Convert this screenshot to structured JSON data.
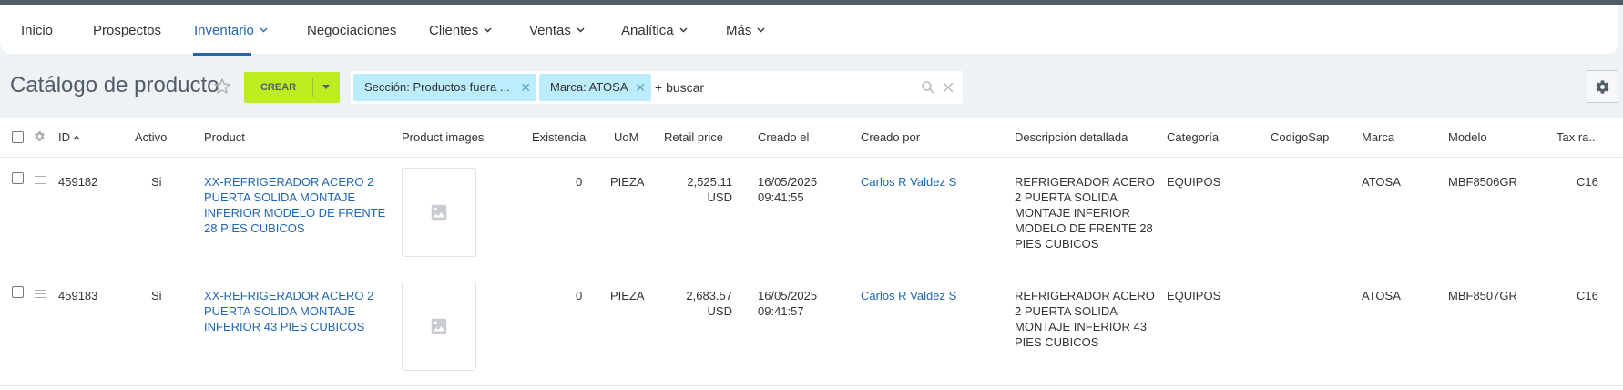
{
  "nav": {
    "items": [
      {
        "label": "Inicio",
        "dropdown": false
      },
      {
        "label": "Prospectos",
        "dropdown": false
      },
      {
        "label": "Inventario",
        "dropdown": true,
        "active": true
      },
      {
        "label": "Negociaciones",
        "dropdown": false
      },
      {
        "label": "Clientes",
        "dropdown": true
      },
      {
        "label": "Ventas",
        "dropdown": true
      },
      {
        "label": "Analítica",
        "dropdown": true
      },
      {
        "label": "Más",
        "dropdown": true
      }
    ]
  },
  "page": {
    "title": "Catálogo de producto",
    "create_label": "CREAR"
  },
  "filters": {
    "tags": [
      "Sección: Productos fuera ...",
      "Marca: ATOSA"
    ],
    "search_placeholder": "+ buscar"
  },
  "table": {
    "headers": [
      "ID",
      "Activo",
      "Product",
      "Product images",
      "Existencia",
      "UoM",
      "Retail price",
      "Creado el",
      "Creado por",
      "Descripción detallada",
      "Categoría",
      "CodigoSap",
      "Marca",
      "Modelo",
      "Tax ra..."
    ],
    "rows": [
      {
        "id": "459182",
        "activo": "Si",
        "product": [
          "XX-REFRIGERADOR ACERO 2",
          "PUERTA SOLIDA MONTAJE",
          "INFERIOR MODELO DE FRENTE",
          "28 PIES CUBICOS"
        ],
        "existencia": "0",
        "uom": "PIEZA",
        "price": [
          "2,525.11",
          "USD"
        ],
        "creado_el": [
          "16/05/2025",
          "09:41:55"
        ],
        "creado_por": "Carlos R Valdez S",
        "descripcion": [
          "REFRIGERADOR ACERO",
          "2 PUERTA SOLIDA",
          "MONTAJE INFERIOR",
          "MODELO DE FRENTE 28",
          "PIES CUBICOS"
        ],
        "categoria": "EQUIPOS",
        "codigosap": "",
        "marca": "ATOSA",
        "modelo": "MBF8506GR",
        "tax": "C16"
      },
      {
        "id": "459183",
        "activo": "Si",
        "product": [
          "XX-REFRIGERADOR ACERO 2",
          "PUERTA SOLIDA MONTAJE",
          "INFERIOR 43 PIES CUBICOS"
        ],
        "existencia": "0",
        "uom": "PIEZA",
        "price": [
          "2,683.57",
          "USD"
        ],
        "creado_el": [
          "16/05/2025",
          "09:41:57"
        ],
        "creado_por": "Carlos R Valdez S",
        "descripcion": [
          "REFRIGERADOR ACERO",
          "2 PUERTA SOLIDA",
          "MONTAJE INFERIOR 43",
          "PIES CUBICOS"
        ],
        "categoria": "EQUIPOS",
        "codigosap": "",
        "marca": "ATOSA",
        "modelo": "MBF8507GR",
        "tax": "C16"
      }
    ]
  },
  "colors": {
    "accent": "#2067b0",
    "create_button": "#bbed21",
    "filter_tag": "#bcedfc",
    "background": "#eef2f4"
  },
  "icons": [
    "chevron-down-icon",
    "star-icon",
    "search-icon",
    "close-icon",
    "gear-icon",
    "drag-handle-icon",
    "image-placeholder-icon",
    "sort-asc-icon"
  ]
}
